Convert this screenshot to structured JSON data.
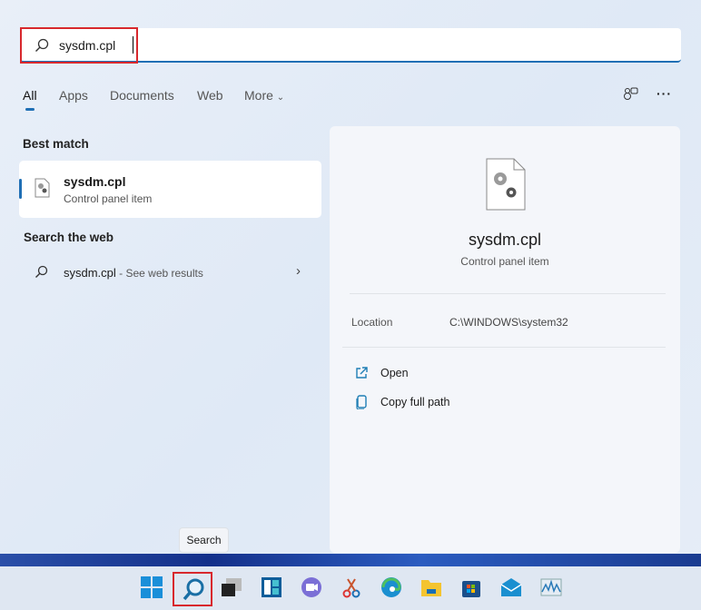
{
  "search": {
    "value": "sysdm.cpl",
    "icon": "search-icon"
  },
  "tabs": [
    {
      "label": "All",
      "active": true
    },
    {
      "label": "Apps"
    },
    {
      "label": "Documents"
    },
    {
      "label": "Web"
    },
    {
      "label": "More"
    }
  ],
  "left": {
    "best_match_heading": "Best match",
    "best_match": {
      "title": "sysdm.cpl",
      "subtitle": "Control panel item"
    },
    "web_heading": "Search the web",
    "web_result": {
      "query": "sysdm.cpl",
      "suffix": " - See web results"
    }
  },
  "detail": {
    "title": "sysdm.cpl",
    "subtitle": "Control panel item",
    "location_label": "Location",
    "location_value": "C:\\WINDOWS\\system32",
    "actions": [
      {
        "label": "Open",
        "icon": "open-external-icon"
      },
      {
        "label": "Copy full path",
        "icon": "copy-icon"
      }
    ]
  },
  "tooltip": "Search",
  "taskbar": [
    "start",
    "search",
    "task-view",
    "widgets",
    "teams-chat",
    "snipping-tool",
    "edge",
    "file-explorer",
    "store",
    "mail",
    "performance-monitor"
  ],
  "colors": {
    "accent": "#1f6fb5",
    "highlight": "#d8282d"
  }
}
